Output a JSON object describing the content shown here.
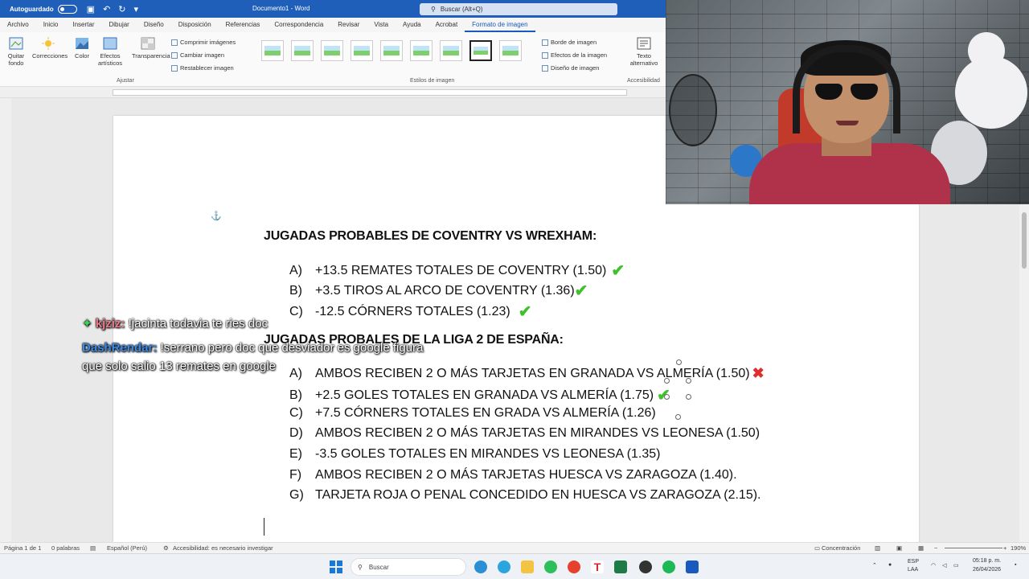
{
  "titlebar": {
    "autosave_label": "Autoguardado",
    "doc_title": "Documento1 - Word",
    "search_placeholder": "Buscar (Alt+Q)"
  },
  "menu": {
    "items": [
      "Archivo",
      "Inicio",
      "Insertar",
      "Dibujar",
      "Diseño",
      "Disposición",
      "Referencias",
      "Correspondencia",
      "Revisar",
      "Vista",
      "Ayuda",
      "Acrobat",
      "Formato de imagen"
    ],
    "active": "Formato de imagen"
  },
  "ribbon": {
    "quitar_fondo": "Quitar fondo",
    "correcciones": "Correcciones",
    "color": "Color",
    "efectos_artisticos": "Efectos artísticos",
    "transparencia": "Transparencia",
    "comprimir": "Comprimir imágenes",
    "cambiar": "Cambiar imagen",
    "restablecer": "Restablecer imagen",
    "group_ajustar": "Ajustar",
    "group_estilos": "Estilos de imagen",
    "borde": "Borde de imagen",
    "efectos": "Efectos de la imagen",
    "diseno": "Diseño de imagen",
    "texto_alt": "Texto alternativo",
    "group_accesibilidad": "Accesibilidad"
  },
  "document": {
    "heading1": "JUGADAS PROBABLES DE COVENTRY VS WREXHAM:",
    "list1": [
      {
        "letter": "A)",
        "text": "+13.5 REMATES TOTALES DE COVENTRY (1.50)",
        "result": "win"
      },
      {
        "letter": "B)",
        "text": "+3.5 TIROS AL ARCO DE COVENTRY (1.36)",
        "result": "win"
      },
      {
        "letter": "C)",
        "text": "-12.5 CÓRNERS TOTALES (1.23)",
        "result": "win"
      }
    ],
    "heading2": "JUGADAS PROBALES DE LA LIGA 2 DE ESPAÑA:",
    "list2": [
      {
        "letter": "A)",
        "text": "AMBOS RECIBEN 2 O MÁS TARJETAS EN GRANADA VS ALMERÍA (1.50)",
        "result": "loss"
      },
      {
        "letter": "B)",
        "text": "+2.5 GOLES TOTALES EN GRANADA VS ALMERÍA (1.75)",
        "result": "win"
      },
      {
        "letter": "C)",
        "text": "+7.5 CÓRNERS TOTALES EN GRADA VS ALMERÍA (1.26)",
        "result": ""
      },
      {
        "letter": "D)",
        "text": "AMBOS RECIBEN 2 O MÁS TARJETAS EN MIRANDES VS LEONESA (1.50)",
        "result": ""
      },
      {
        "letter": "E)",
        "text": "-3.5 GOLES TOTALES EN MIRANDES VS LEONESA (1.35)",
        "result": ""
      },
      {
        "letter": "F)",
        "text": "AMBOS RECIBEN 2 O MÁS TARJETAS HUESCA VS ZARAGOZA (1.40).",
        "result": ""
      },
      {
        "letter": "G)",
        "text": "TARJETA ROJA O PENAL CONCEDIDO EN HUESCA VS ZARAGOZA (2.15).",
        "result": ""
      }
    ],
    "check_mark": "✔",
    "cross_mark": "✖"
  },
  "chat": {
    "msg1_user": "kjziz:",
    "msg1_text": " !jacinta todavia te ries doc",
    "msg2_user": "DashRendar:",
    "msg2_text": " !serrano pero doc que desviador es google figura",
    "msg2_cont": "que solo salio 13 remates en google"
  },
  "status": {
    "page": "Página 1 de 1",
    "words": "0 palabras",
    "language": "Español (Perú)",
    "accessibility": "Accesibilidad: es necesario investigar",
    "focus": "Concentración",
    "zoom": "190%"
  },
  "taskbar": {
    "search": "Buscar",
    "lang_top": "ESP",
    "lang_bottom": "LAA",
    "time": "05:18 p. m.",
    "date": "26/04/2026"
  },
  "colors": {
    "word_blue": "#1f5fba",
    "check_green": "#3ec12b",
    "cross_red": "#e12d2d"
  }
}
